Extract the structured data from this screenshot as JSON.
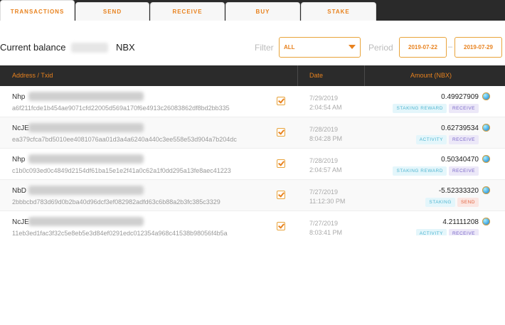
{
  "tabs": [
    {
      "label": "TRANSACTIONS",
      "active": true
    },
    {
      "label": "SEND",
      "active": false
    },
    {
      "label": "RECEIVE",
      "active": false
    },
    {
      "label": "BUY",
      "active": false
    },
    {
      "label": "STAKE",
      "active": false
    }
  ],
  "balance": {
    "label": "Current balance",
    "currency": "NBX"
  },
  "filter": {
    "label": "Filter",
    "value": "ALL"
  },
  "period": {
    "label": "Period",
    "from": "2019-07-22",
    "separator": "–",
    "to": "2019-07-29"
  },
  "table": {
    "headers": {
      "address": "Address / Txid",
      "date": "Date",
      "amount": "Amount (NBX)"
    },
    "rows": [
      {
        "address_prefix": "Nhp",
        "txid": "a6f211fcde1b454ae9071cfd22005d569a170f6e4913c26083862df8bd2bb335",
        "date": "7/29/2019",
        "time": "2:04:54 AM",
        "amount": "0.49927909",
        "badges": [
          "STAKING REWARD",
          "RECEIVE"
        ]
      },
      {
        "address_prefix": "NcJE",
        "txid": "ea379cfca7bd5010ee4081076aa01d3a4a6240a440c3ee558e53d904a7b204dc",
        "date": "7/28/2019",
        "time": "8:04:28 PM",
        "amount": "0.62739534",
        "badges": [
          "ACTIVITY",
          "RECEIVE"
        ]
      },
      {
        "address_prefix": "Nhp",
        "txid": "c1b0c093ed0c4849d2154df61ba15e1e2f41a0c62a1f0dd295a13fe8aec41223",
        "date": "7/28/2019",
        "time": "2:04:57 AM",
        "amount": "0.50340470",
        "badges": [
          "STAKING REWARD",
          "RECEIVE"
        ]
      },
      {
        "address_prefix": "NbD",
        "txid": "2bbbcbd783d69d0b2ba40d96dcf3ef082982adfd63c6b88a2b3fc385c3329",
        "date": "7/27/2019",
        "time": "11:12:30 PM",
        "amount": "-5.52333320",
        "badges": [
          "STAKING",
          "SEND"
        ]
      },
      {
        "address_prefix": "NcJE",
        "txid": "11eb3ed1fac3f32c5e8eb5e3d84ef0291edc012354a968c41538b98056f4b5a",
        "date": "7/27/2019",
        "time": "8:03:41 PM",
        "amount": "4.21111208",
        "badges": [
          "ACTIVITY",
          "RECEIVE"
        ]
      }
    ]
  },
  "colors": {
    "accent": "#e8821e",
    "header_bg": "#2b2b2b",
    "receive": "#7a68c9",
    "send": "#e2643f",
    "staking": "#4fb5d0"
  },
  "icons": {
    "confirmed": "check-box-icon",
    "coin": "nbx-coin-icon",
    "dropdown": "caret-down-icon"
  }
}
